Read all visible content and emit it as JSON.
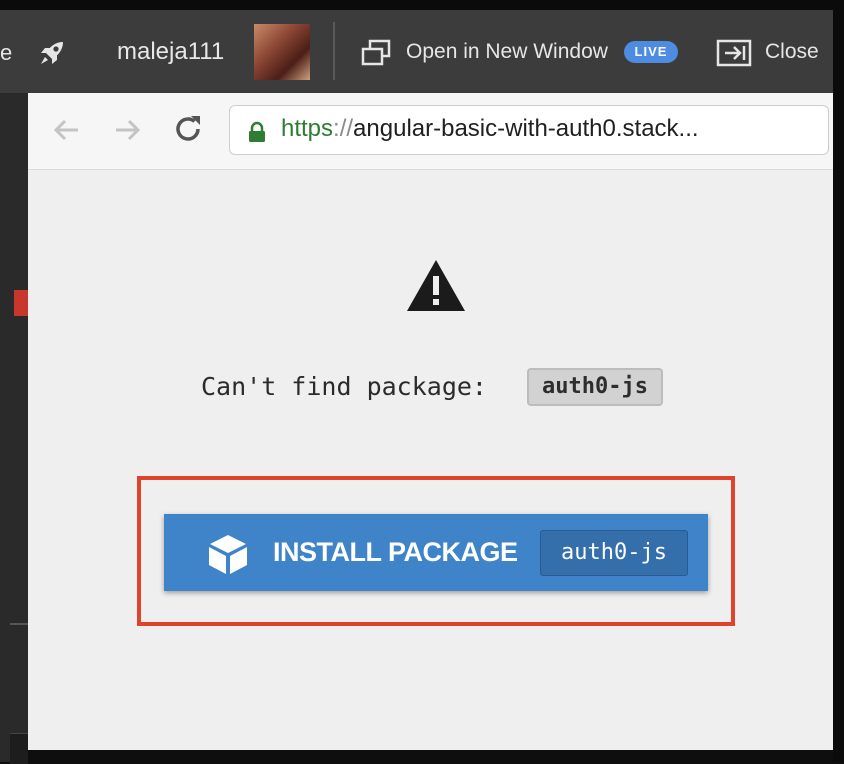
{
  "toolbar": {
    "partial_label": "e",
    "username": "maleja111",
    "open_new_window_label": "Open in New Window",
    "live_badge": "LIVE",
    "close_label": "Close"
  },
  "browser": {
    "url_scheme": "https",
    "url_separator": "://",
    "url_host": "angular-basic-with-auth0.stack..."
  },
  "error": {
    "message": "Can't find package:",
    "package_name": "auth0-js"
  },
  "install_button": {
    "label": "INSTALL PACKAGE",
    "package_name": "auth0-js"
  },
  "colors": {
    "toolbar_bg": "#3c3c3c",
    "live_badge": "#4d8ce0",
    "install_button": "#3f84c9",
    "highlight_border": "#e0432c",
    "url_scheme": "#2e7d32"
  },
  "icons": [
    "rocket-icon",
    "new-window-icon",
    "close-panel-icon",
    "back-arrow-icon",
    "forward-arrow-icon",
    "reload-icon",
    "lock-icon",
    "warning-icon",
    "package-cube-icon"
  ]
}
